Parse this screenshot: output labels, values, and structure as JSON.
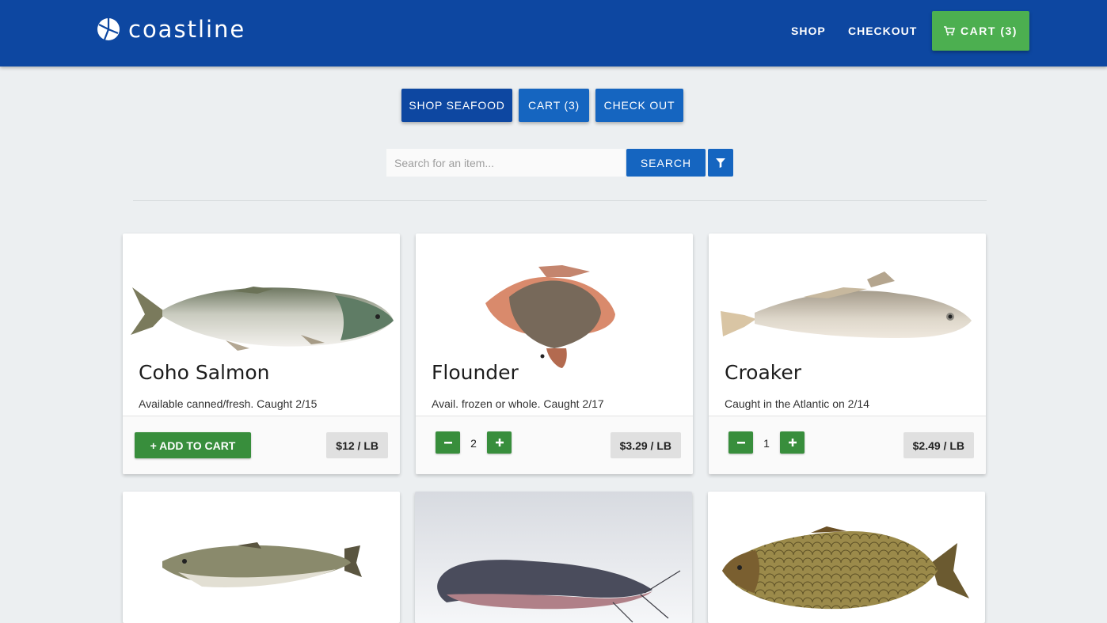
{
  "header": {
    "brand": "coastline",
    "nav": {
      "shop": "SHOP",
      "checkout": "CHECKOUT",
      "cart": "CART (3)"
    }
  },
  "actions": {
    "shop_seafood": "SHOP SEAFOOD",
    "cart": "CART (3)",
    "check_out": "CHECK OUT"
  },
  "search": {
    "placeholder": "Search for an item...",
    "button": "SEARCH"
  },
  "products": [
    {
      "name": "Coho Salmon",
      "description": "Available canned/fresh. Caught 2/15",
      "price": "$12 / LB",
      "add_label": "+ ADD TO CART"
    },
    {
      "name": "Flounder",
      "description": "Avail. frozen or whole. Caught 2/17",
      "price": "$3.29 / LB",
      "quantity": "2"
    },
    {
      "name": "Croaker",
      "description": "Caught in the Atlantic on 2/14",
      "price": "$2.49 / LB",
      "quantity": "1"
    }
  ],
  "colors": {
    "header": "#0d47a1",
    "primary_button": "#1565c0",
    "cart_green": "#4caf50",
    "action_green": "#388e3c",
    "background": "#eceff1"
  },
  "icons": [
    "logo-mark-icon",
    "cart-icon",
    "filter-icon",
    "minus-icon",
    "plus-icon",
    "fish-image"
  ]
}
